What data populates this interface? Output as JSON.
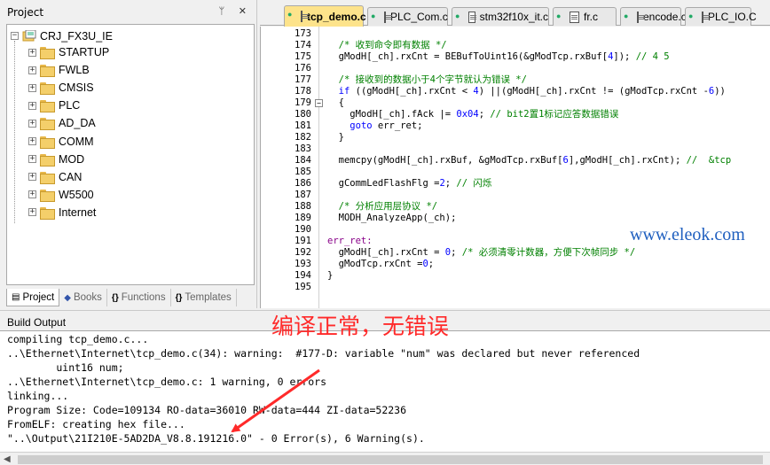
{
  "project": {
    "title": "Project",
    "header_icons": "ᛘ ✕",
    "root": "CRJ_FX3U_IE",
    "folders": [
      "STARTUP",
      "FWLB",
      "CMSIS",
      "PLC",
      "AD_DA",
      "COMM",
      "MOD",
      "CAN",
      "W5500",
      "Internet"
    ],
    "bottom_tabs": [
      {
        "label": "Project",
        "icon": "project-icon"
      },
      {
        "label": "Books",
        "icon": "books-icon"
      },
      {
        "label": "Functions",
        "icon": "braces-icon"
      },
      {
        "label": "Templates",
        "icon": "template-icon"
      }
    ]
  },
  "editor_tabs": [
    {
      "label": "tcp_demo.c",
      "active": true
    },
    {
      "label": "PLC_Com.c",
      "active": false
    },
    {
      "label": "stm32f10x_it.c",
      "active": false
    },
    {
      "label": "fr.c",
      "active": false
    },
    {
      "label": "encode.c",
      "active": false
    },
    {
      "label": "PLC_IO.C",
      "active": false
    }
  ],
  "code_lines": [
    {
      "n": "173",
      "parts": []
    },
    {
      "n": "174",
      "parts": [
        {
          "t": "  "
        },
        {
          "t": "/* 收到命令即有数据 */",
          "c": "comment"
        }
      ]
    },
    {
      "n": "175",
      "parts": [
        {
          "t": "  gModH[_ch].rxCnt = BEBufToUint16(&gModTcp.rxBuf["
        },
        {
          "t": "4",
          "c": "num"
        },
        {
          "t": "]); "
        },
        {
          "t": "// 4 5",
          "c": "comment"
        }
      ]
    },
    {
      "n": "176",
      "parts": []
    },
    {
      "n": "177",
      "parts": [
        {
          "t": "  "
        },
        {
          "t": "/* 接收到的数据小于4个字节就认为错误 */",
          "c": "comment"
        }
      ]
    },
    {
      "n": "178",
      "parts": [
        {
          "t": "  "
        },
        {
          "t": "if",
          "c": "kw"
        },
        {
          "t": " ((gModH[_ch].rxCnt < "
        },
        {
          "t": "4",
          "c": "num"
        },
        {
          "t": ") ||(gModH[_ch].rxCnt != (gModTcp.rxCnt -"
        },
        {
          "t": "6",
          "c": "num"
        },
        {
          "t": "))"
        }
      ]
    },
    {
      "n": "179",
      "parts": [
        {
          "t": "  {"
        }
      ]
    },
    {
      "n": "180",
      "parts": [
        {
          "t": "    gModH[_ch].fAck |= "
        },
        {
          "t": "0x04",
          "c": "num"
        },
        {
          "t": "; "
        },
        {
          "t": "// bit2置1标记应答数据错误",
          "c": "comment"
        }
      ]
    },
    {
      "n": "181",
      "parts": [
        {
          "t": "    "
        },
        {
          "t": "goto",
          "c": "kw"
        },
        {
          "t": " err_ret;"
        }
      ]
    },
    {
      "n": "182",
      "parts": [
        {
          "t": "  }"
        }
      ]
    },
    {
      "n": "183",
      "parts": []
    },
    {
      "n": "184",
      "parts": [
        {
          "t": "  memcpy(gModH[_ch].rxBuf, &gModTcp.rxBuf["
        },
        {
          "t": "6",
          "c": "num"
        },
        {
          "t": "],gModH[_ch].rxCnt); "
        },
        {
          "t": "//  &tcp",
          "c": "comment"
        }
      ]
    },
    {
      "n": "185",
      "parts": []
    },
    {
      "n": "186",
      "parts": [
        {
          "t": "  gCommLedFlashFlg ="
        },
        {
          "t": "2",
          "c": "num"
        },
        {
          "t": "; "
        },
        {
          "t": "// 闪烁",
          "c": "comment"
        }
      ]
    },
    {
      "n": "187",
      "parts": []
    },
    {
      "n": "188",
      "parts": [
        {
          "t": "  "
        },
        {
          "t": "/* 分析应用层协议 */",
          "c": "comment"
        }
      ]
    },
    {
      "n": "189",
      "parts": [
        {
          "t": "  MODH_AnalyzeApp(_ch);"
        }
      ]
    },
    {
      "n": "190",
      "parts": []
    },
    {
      "n": "191",
      "parts": [
        {
          "t": "err_ret:",
          "c": "label"
        }
      ]
    },
    {
      "n": "192",
      "parts": [
        {
          "t": "  gModH[_ch].rxCnt = "
        },
        {
          "t": "0",
          "c": "num"
        },
        {
          "t": "; "
        },
        {
          "t": "/* 必须清零计数器，方便下次帧同步 */",
          "c": "comment"
        }
      ]
    },
    {
      "n": "193",
      "parts": [
        {
          "t": "  gModTcp.rxCnt ="
        },
        {
          "t": "0",
          "c": "num"
        },
        {
          "t": ";"
        }
      ]
    },
    {
      "n": "194",
      "parts": [
        {
          "t": "}"
        }
      ]
    },
    {
      "n": "195",
      "parts": []
    }
  ],
  "watermark": "www.eleok.com",
  "build": {
    "title": "Build Output",
    "annotation": "编译正常，无错误",
    "lines": [
      "compiling tcp_demo.c...",
      "..\\Ethernet\\Internet\\tcp_demo.c(34): warning:  #177-D: variable \"num\" was declared but never referenced",
      "        uint16 num;",
      "..\\Ethernet\\Internet\\tcp_demo.c: 1 warning, 0 errors",
      "linking...",
      "Program Size: Code=109134 RO-data=36010 RW-data=444 ZI-data=52236",
      "FromELF: creating hex file...",
      "\"..\\Output\\21I210E-5AD2DA_V8.8.191216.0\" - 0 Error(s), 6 Warning(s)."
    ]
  },
  "colors": {
    "active_tab": "#fde38b",
    "comment": "#008000",
    "keyword": "#0000ff",
    "annotation": "#ff2a2a",
    "watermark": "#1f5fbf"
  }
}
